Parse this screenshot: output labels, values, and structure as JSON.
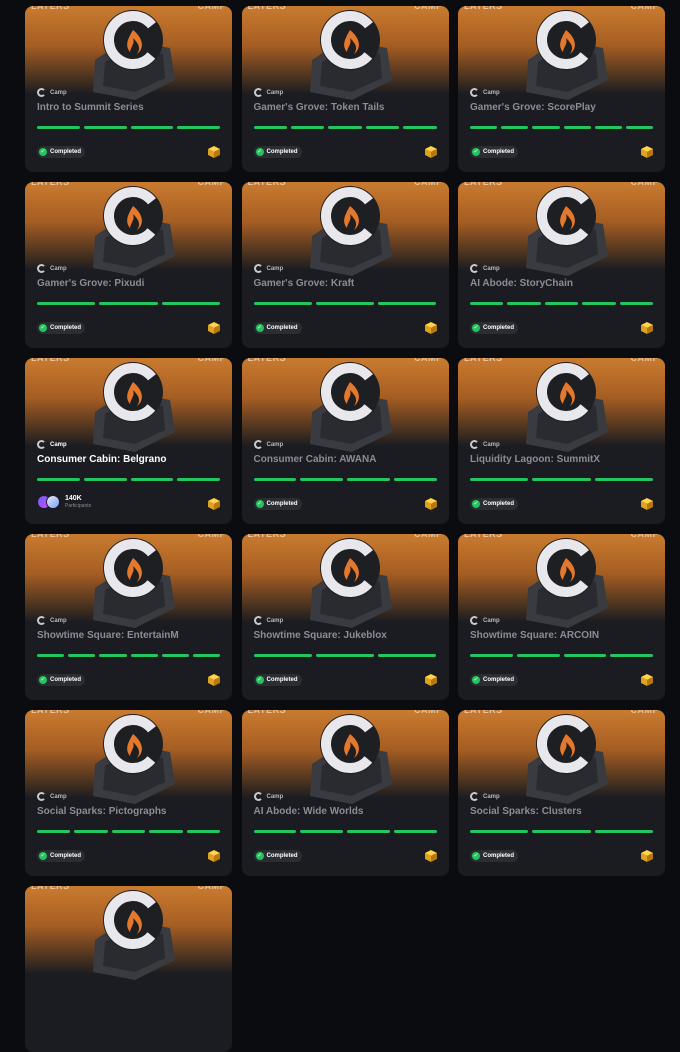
{
  "banner": {
    "left_tag": "LAYERS",
    "right_tag": "CAMP"
  },
  "camp_label": "Camp",
  "status_label": "Completed",
  "participants": {
    "count": "140K",
    "label": "Participants"
  },
  "colors": {
    "accent_green": "#22c55e",
    "card_bg": "#1b1c21",
    "banner_orange": "#c97b2f"
  },
  "cards": [
    {
      "title": "Intro to Summit Series",
      "segments": 4,
      "status": "completed"
    },
    {
      "title": "Gamer's Grove: Token Tails",
      "segments": 5,
      "status": "completed"
    },
    {
      "title": "Gamer's Grove: ScorePlay",
      "segments": 6,
      "status": "completed"
    },
    {
      "title": "Gamer's Grove: Pixudi",
      "segments": 3,
      "status": "completed"
    },
    {
      "title": "Gamer's Grove: Kraft",
      "segments": 3,
      "status": "completed"
    },
    {
      "title": "AI Abode: StoryChain",
      "segments": 5,
      "status": "completed"
    },
    {
      "title": "Consumer Cabin: Belgrano",
      "segments": 4,
      "status": "active"
    },
    {
      "title": "Consumer Cabin: AWANA",
      "segments": 4,
      "status": "completed"
    },
    {
      "title": "Liquidity Lagoon: SummitX",
      "segments": 3,
      "status": "completed"
    },
    {
      "title": "Showtime Square: EntertainM",
      "segments": 6,
      "status": "completed"
    },
    {
      "title": "Showtime Square: Jukeblox",
      "segments": 3,
      "status": "completed"
    },
    {
      "title": "Showtime Square: ARCOIN",
      "segments": 4,
      "status": "completed"
    },
    {
      "title": "Social Sparks: Pictographs",
      "segments": 5,
      "status": "completed"
    },
    {
      "title": "AI Abode: Wide Worlds",
      "segments": 4,
      "status": "completed"
    },
    {
      "title": "Social Sparks: Clusters",
      "segments": 3,
      "status": "completed"
    },
    {
      "title": "",
      "segments": 0,
      "status": "partial"
    }
  ]
}
